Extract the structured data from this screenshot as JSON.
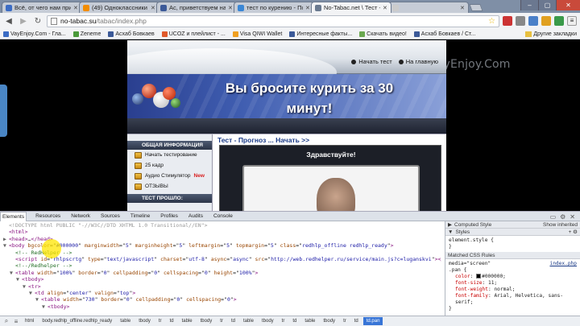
{
  "tabs": [
    {
      "title": "Всё, от чего нам приятно",
      "favicon": "#3b6cc4",
      "active": false
    },
    {
      "title": "(49) Одноклассники",
      "favicon": "#f28c00",
      "active": false
    },
    {
      "title": "Ас, приветствуем на Facebook",
      "favicon": "#3b5998",
      "active": false
    },
    {
      "title": "тест по курению - Поиск",
      "favicon": "#3a87d6",
      "active": false
    },
    {
      "title": "No-Tabac.net \\ Тест - Прогноз",
      "favicon": "#6a7a90",
      "active": true
    },
    {
      "title": "",
      "favicon": "#cccccc",
      "active": false
    }
  ],
  "address": {
    "host": "no-tabac.su",
    "path": "/tabac/index.php"
  },
  "bookmarks": [
    {
      "label": "VayEnjoy.Com - Гла...",
      "color": "#3b6cc4"
    },
    {
      "label": "Zeneme",
      "color": "#4a9a3a"
    },
    {
      "label": "Асхаб Бовкаев",
      "color": "#3b5998"
    },
    {
      "label": "UCOZ и плейлист - ...",
      "color": "#e05a2a"
    },
    {
      "label": "Visa QIWI Wallet",
      "color": "#f0a020"
    },
    {
      "label": "Интересные факты...",
      "color": "#3b5998"
    },
    {
      "label": "Скачать видео!",
      "color": "#6aa84f"
    },
    {
      "label": "Асхаб Бовкаев / Ст...",
      "color": "#3b5998"
    }
  ],
  "bookmarks_other": "Другие закладки",
  "watermark": "VayEnjoy.Com",
  "site": {
    "nav": [
      "Начать тест",
      "На главную"
    ],
    "banner_title": "Вы бросите курить за 30 минут!",
    "menu_header": "ОБЩАЯ ИНФОРМАЦИЯ",
    "menu": [
      {
        "label": "Начать тестирование",
        "badge": ""
      },
      {
        "label": "25 кадр",
        "badge": ""
      },
      {
        "label": "Аудио Стимулятор",
        "badge": "New"
      },
      {
        "label": "ОТЗЫВЫ",
        "badge": ""
      }
    ],
    "menu_header2": "ТЕСТ ПРОШЛО:",
    "quiz_link": "Тест - Прогноз ... Начать >>",
    "hello": "Здравствуйте!"
  },
  "devtools": {
    "tabs": [
      "Elements",
      "Resources",
      "Network",
      "Sources",
      "Timeline",
      "Profiles",
      "Audits",
      "Console"
    ],
    "active_tab": "Elements",
    "styles_tabs": {
      "computed": "Computed Style",
      "show_inherited": "Show inherited",
      "styles": "Styles"
    },
    "element_style": "element.style {",
    "matched_header": "Matched CSS Rules",
    "media": "media=\"screen\"",
    "selector": ".pan {",
    "source": "index.php",
    "props": [
      {
        "name": "color",
        "value": "#000000;"
      },
      {
        "name": "font-size",
        "value": "11;"
      },
      {
        "name": "font-weight",
        "value": "normal;"
      },
      {
        "name": "font-family",
        "value": "Arial, Helvetica, sans-serif;"
      }
    ],
    "breadcrumbs": [
      "html",
      "body.redhlp_offline.redhlp_ready",
      "table",
      "tbody",
      "tr",
      "td",
      "table",
      "tbody",
      "tr",
      "td",
      "table",
      "tbody",
      "tr",
      "td",
      "table",
      "tbody",
      "tr",
      "td",
      "td.pan"
    ],
    "active_crumb": 18
  },
  "code_lines": [
    {
      "indent": 0,
      "arrow": "",
      "sel": false,
      "html": "<span class='doc'>&lt;!DOCTYPE html PUBLIC \"-//W3C//DTD XHTML 1.0 Transitional//EN\"&gt;</span>"
    },
    {
      "indent": 0,
      "arrow": "",
      "sel": false,
      "html": "<span class='tagc'>&lt;html&gt;</span>"
    },
    {
      "indent": 0,
      "arrow": "▶",
      "sel": false,
      "html": "<span class='tagc'>&lt;head&gt;</span>…<span class='tagc'>&lt;/head&gt;</span>"
    },
    {
      "indent": 0,
      "arrow": "▼",
      "sel": false,
      "html": "<span class='tagc'>&lt;body</span> <span class='attr'>bgcolor</span>=\"<span class='val'>#000000</span>\" <span class='attr'>marginwidth</span>=\"<span class='val'>5</span>\" <span class='attr'>marginheight</span>=\"<span class='val'>5</span>\" <span class='attr'>leftmargin</span>=\"<span class='val'>5</span>\" <span class='attr'>topmargin</span>=\"<span class='val'>5</span>\" <span class='attr'>class</span>=\"<span class='val'>redhlp_offline redhlp_ready</span>\"<span class='tagc'>&gt;</span>"
    },
    {
      "indent": 1,
      "arrow": "",
      "sel": false,
      "html": "<span class='cmt'>&lt;!-- RedHelper --&gt;</span>"
    },
    {
      "indent": 1,
      "arrow": "",
      "sel": false,
      "html": "<span class='tagc'>&lt;script</span> <span class='attr'>id</span>=\"<span class='val'>rhlpscrtg</span>\" <span class='attr'>type</span>=\"<span class='val'>text/javascript</span>\" <span class='attr'>charset</span>=\"<span class='val'>utf-8</span>\" <span class='attr'>async</span>=\"<span class='val'>async</span>\" <span class='attr'>src</span>=\"<span class='val'>http://web.redhelper.ru/service/main.js?c=luganskvi</span>\"<span class='tagc'>&gt;&lt;/script&gt;</span>"
    },
    {
      "indent": 1,
      "arrow": "",
      "sel": false,
      "html": "<span class='cmt'>&lt;!--/Redhelper --&gt;</span>"
    },
    {
      "indent": 1,
      "arrow": "▼",
      "sel": false,
      "html": "<span class='tagc'>&lt;table</span> <span class='attr'>width</span>=\"<span class='val'>100%</span>\" <span class='attr'>border</span>=\"<span class='val'>0</span>\" <span class='attr'>cellpadding</span>=\"<span class='val'>0</span>\" <span class='attr'>cellspacing</span>=\"<span class='val'>0</span>\" <span class='attr'>height</span>=\"<span class='val'>100%</span>\"<span class='tagc'>&gt;</span>"
    },
    {
      "indent": 2,
      "arrow": "▼",
      "sel": false,
      "html": "<span class='tagc'>&lt;tbody&gt;</span>"
    },
    {
      "indent": 3,
      "arrow": "▼",
      "sel": false,
      "html": "<span class='tagc'>&lt;tr&gt;</span>"
    },
    {
      "indent": 4,
      "arrow": "▼",
      "sel": false,
      "html": "<span class='tagc'>&lt;td</span> <span class='attr'>align</span>=\"<span class='val'>center</span>\" <span class='attr'>valign</span>=\"<span class='val'>top</span>\"<span class='tagc'>&gt;</span>"
    },
    {
      "indent": 5,
      "arrow": "▼",
      "sel": false,
      "html": "<span class='tagc'>&lt;table</span> <span class='attr'>width</span>=\"<span class='val'>730</span>\" <span class='attr'>border</span>=\"<span class='val'>0</span>\" <span class='attr'>cellpadding</span>=\"<span class='val'>0</span>\" <span class='attr'>cellspacing</span>=\"<span class='val'>0</span>\"<span class='tagc'>&gt;</span>"
    },
    {
      "indent": 6,
      "arrow": "▼",
      "sel": false,
      "html": "<span class='tagc'>&lt;tbody&gt;</span>"
    }
  ]
}
